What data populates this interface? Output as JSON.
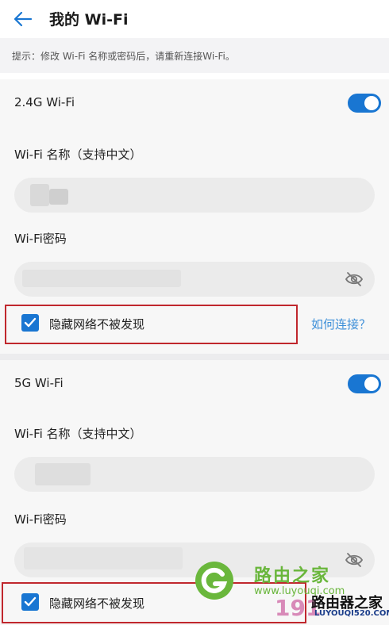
{
  "header": {
    "title": "我的 Wi-Fi"
  },
  "tip": "提示：修改 Wi-Fi 名称或密码后，请重新连接Wi-Fi。",
  "bands": [
    {
      "label": "2.4G Wi-Fi",
      "enabled": true,
      "name_label": "Wi-Fi 名称（支持中文）",
      "name_value": "",
      "password_label": "Wi-Fi密码",
      "password_value": "",
      "hide_label": "隐藏网络不被发现",
      "hide_checked": true,
      "help_link": "如何连接？"
    },
    {
      "label": "5G Wi-Fi",
      "enabled": true,
      "name_label": "Wi-Fi 名称（支持中文）",
      "name_value": "",
      "password_label": "Wi-Fi密码",
      "password_value": "",
      "hide_label": "隐藏网络不被发现",
      "hide_checked": true
    }
  ],
  "watermark": {
    "cn": "路由之家",
    "en": "www.luyouqi.com",
    "num": "191",
    "brand": "路由器之家",
    "url": "LUYOUQI520.COM"
  },
  "colors": {
    "accent": "#1976d2",
    "link": "#3d8fd8",
    "highlight": "#c0272d"
  }
}
